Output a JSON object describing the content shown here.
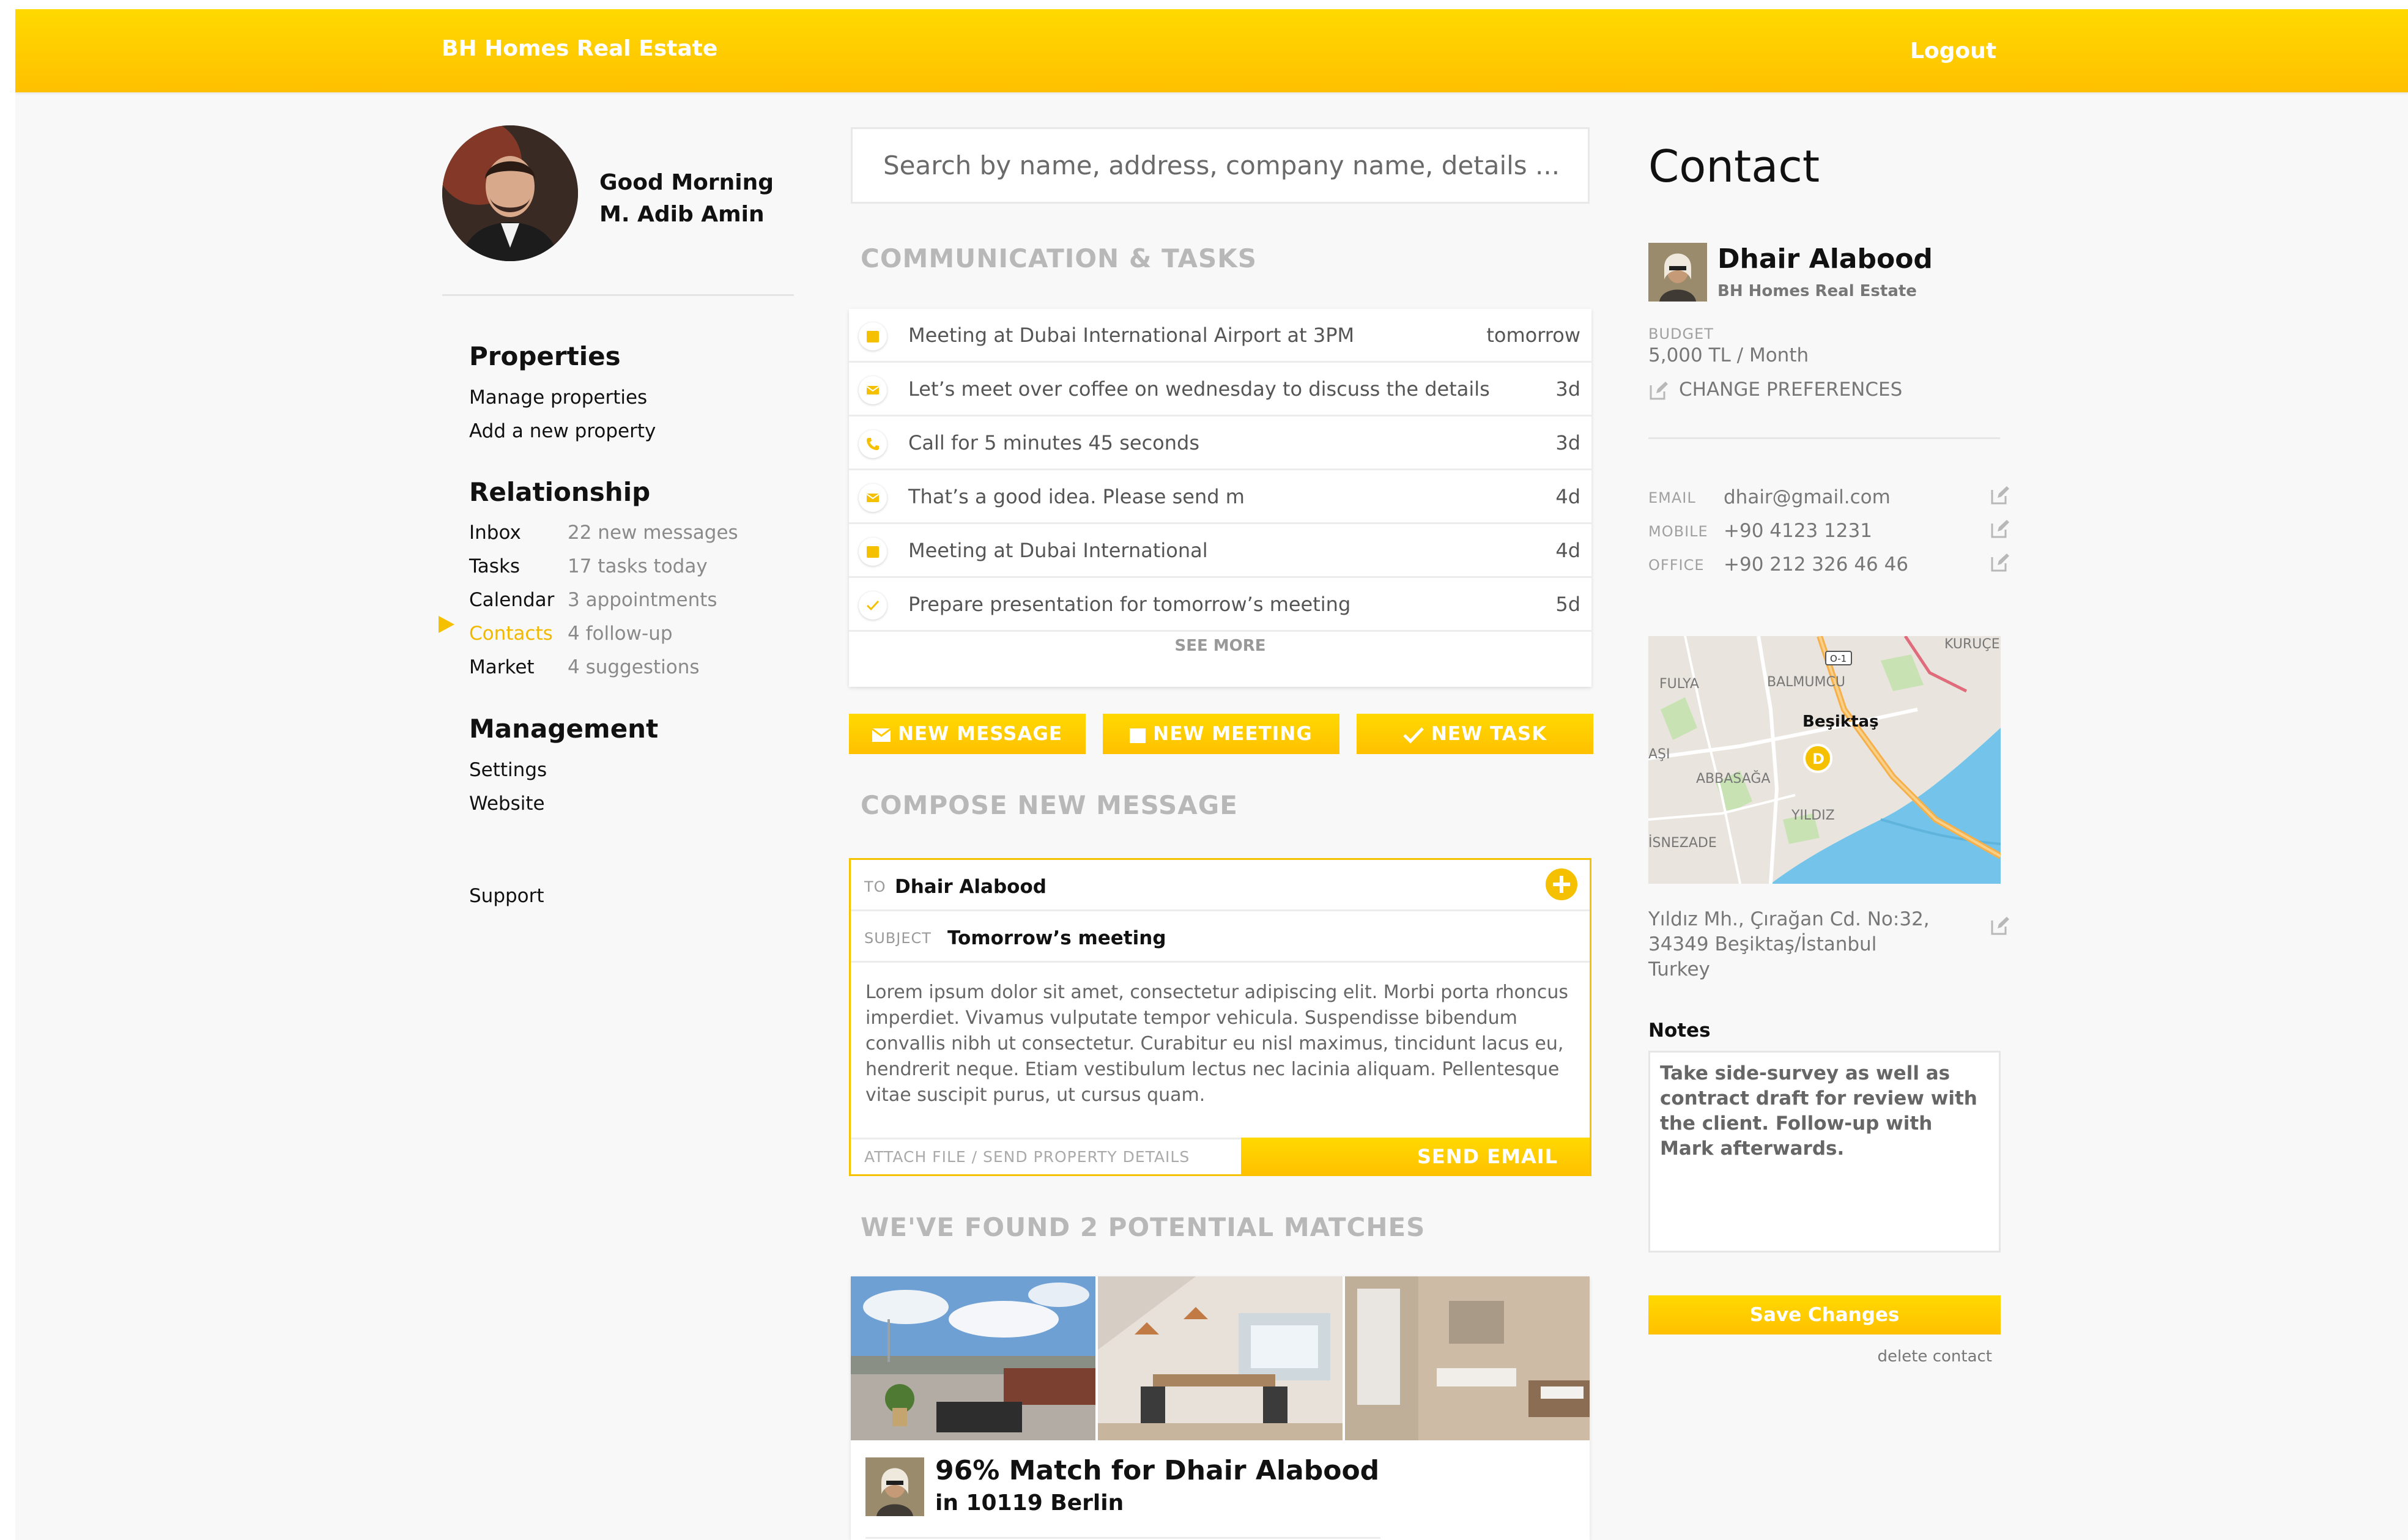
{
  "header": {
    "brand": "BH Homes Real Estate",
    "logout": "Logout"
  },
  "user": {
    "greeting": "Good Morning",
    "name": "M. Adib Amin"
  },
  "nav": {
    "properties": {
      "title": "Properties",
      "items": [
        "Manage properties",
        "Add a new property"
      ]
    },
    "relationship": {
      "title": "Relationship",
      "items": [
        {
          "label": "Inbox",
          "count": "22 new messages"
        },
        {
          "label": "Tasks",
          "count": "17 tasks today"
        },
        {
          "label": "Calendar",
          "count": "3 appointments"
        },
        {
          "label": "Contacts",
          "count": "4 follow-up",
          "active": true
        },
        {
          "label": "Market",
          "count": "4 suggestions"
        }
      ]
    },
    "management": {
      "title": "Management",
      "items": [
        "Settings",
        "Website"
      ]
    },
    "support": "Support"
  },
  "search": {
    "placeholder": "Search by name, address, company name, details ..."
  },
  "communication": {
    "title": "COMMUNICATION & TASKS",
    "tasks": [
      {
        "icon": "calendar-icon",
        "text": "Meeting at Dubai International Airport at 3PM",
        "due": "tomorrow"
      },
      {
        "icon": "envelope-icon",
        "text": "Let’s meet over coffee on wednesday to discuss the details",
        "due": "3d"
      },
      {
        "icon": "phone-icon",
        "text": "Call for 5 minutes 45 seconds",
        "due": "3d"
      },
      {
        "icon": "envelope-icon",
        "text": "That’s a good idea. Please send m",
        "due": "4d"
      },
      {
        "icon": "calendar-icon",
        "text": "Meeting at Dubai International",
        "due": "4d"
      },
      {
        "icon": "check-icon",
        "text": "Prepare presentation for tomorrow’s meeting",
        "due": "5d"
      }
    ],
    "see_more": "SEE MORE"
  },
  "actions": {
    "new_message": "NEW MESSAGE",
    "new_meeting": "NEW MEETING",
    "new_task": "NEW TASK"
  },
  "compose": {
    "title": "COMPOSE NEW MESSAGE",
    "to_label": "TO",
    "to_value": "Dhair Alabood",
    "subject_label": "SUBJECT",
    "subject_value": "Tomorrow’s meeting",
    "body": "Lorem ipsum dolor sit amet, consectetur adipiscing elit. Morbi porta rhoncus imperdiet. Vivamus vulputate tempor vehicula. Suspendisse bibendum convallis nibh ut consectetur. Curabitur eu nisl maximus, tincidunt lacus eu, hendrerit neque. Etiam vestibulum lectus nec lacinia aliquam. Pellentesque vitae suscipit purus, ut cursus quam.",
    "attach": "ATTACH FILE / SEND PROPERTY DETAILS",
    "send": "SEND EMAIL"
  },
  "matches": {
    "title": "WE'VE FOUND 2 POTENTIAL MATCHES",
    "headline": "96% Match for Dhair Alabood",
    "location": "in 10119 Berlin"
  },
  "contact": {
    "heading": "Contact",
    "name": "Dhair Alabood",
    "company": "BH Homes Real Estate",
    "budget_label": "BUDGET",
    "budget_value": "5,000 TL / Month",
    "change_prefs": "CHANGE PREFERENCES",
    "email_label": "EMAIL",
    "email": "dhair@gmail.com",
    "mobile_label": "MOBILE",
    "mobile": "+90 4123 1231",
    "office_label": "OFFICE",
    "office": "+90 212 326 46 46",
    "map_labels": [
      "KURUÇE",
      "FULYA",
      "BALMUMCU",
      "Beşiktaş",
      "AŞI",
      "ABBASAĞA",
      "YILDIZ",
      "İSNEZADE",
      "O-1",
      "D"
    ],
    "address_line1": "Yıldız Mh., Çırağan Cd. No:32,",
    "address_line2": "34349 Beşiktaş/İstanbul",
    "address_line3": "Turkey",
    "notes_label": "Notes",
    "notes": "Take side-survey as well as contract draft for review with the client. Follow-up with Mark afterwards.",
    "save": "Save Changes",
    "delete": "delete contact"
  },
  "colors": {
    "accent": "#FFC800",
    "accent_light": "#FFD900",
    "text_muted": "#777777",
    "background": "#F8F8F8"
  }
}
